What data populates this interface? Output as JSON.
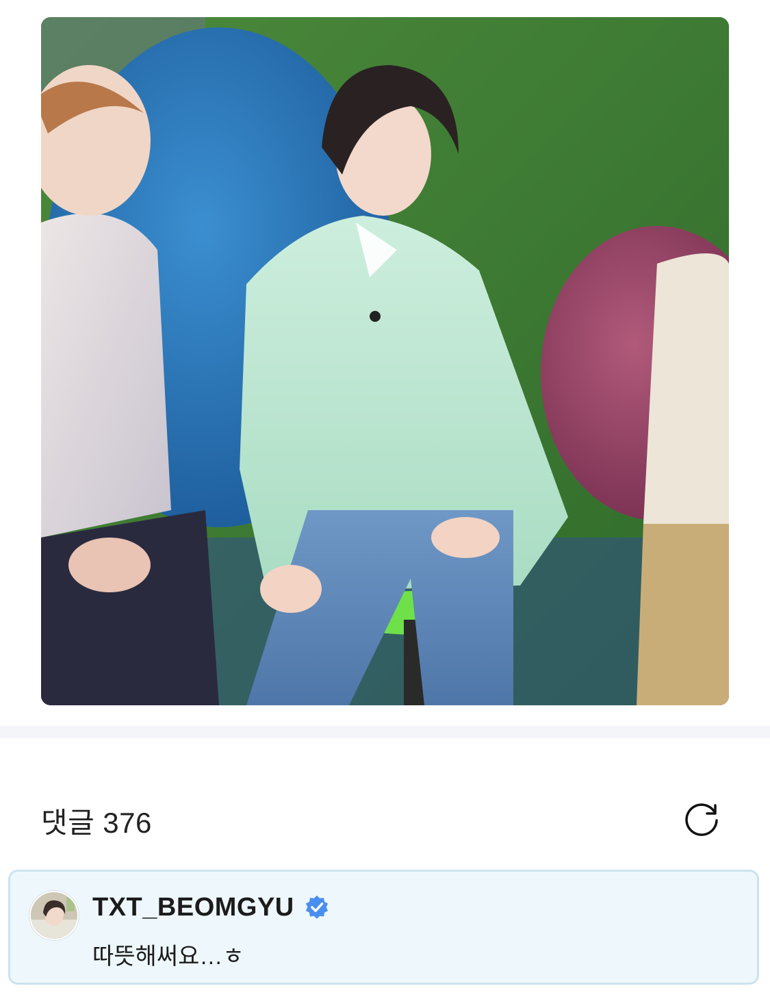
{
  "post": {
    "image": {
      "subject": "post-photo"
    }
  },
  "comments": {
    "title": "댓글",
    "count": "376",
    "refresh_icon": "refresh-icon"
  },
  "artist_comment": {
    "author": "TXT_BEOMGYU",
    "verified_icon": "verified-badge-icon",
    "text": "따뜻해써요…ㅎ",
    "highlight_color": "#eef8fc",
    "border_color": "#cbe3ef",
    "badge_color": "#4a8ff0"
  }
}
